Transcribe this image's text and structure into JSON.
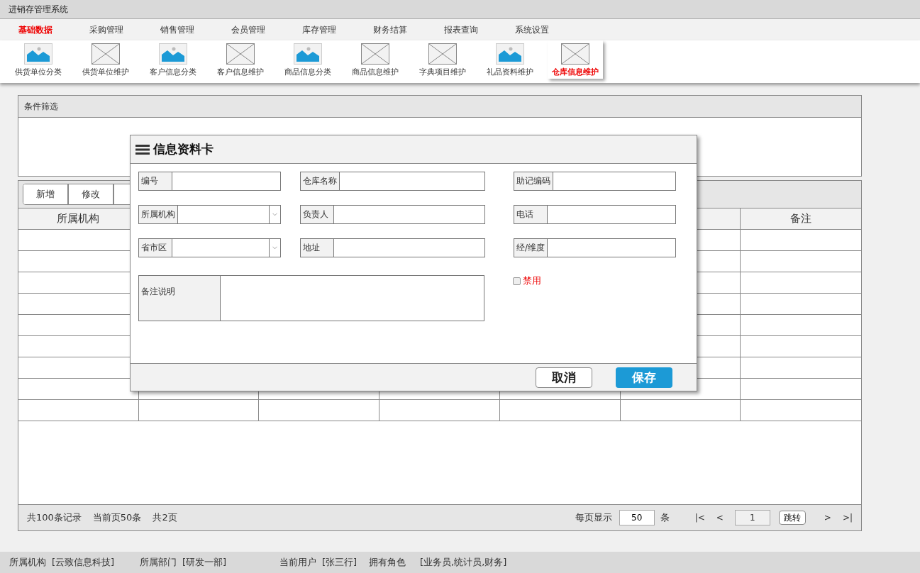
{
  "app_title": "进销存管理系统",
  "menu": [
    {
      "label": "基础数据",
      "selected": true
    },
    {
      "label": "采购管理",
      "selected": false
    },
    {
      "label": "销售管理",
      "selected": false
    },
    {
      "label": "会员管理",
      "selected": false
    },
    {
      "label": "库存管理",
      "selected": false
    },
    {
      "label": "财务结算",
      "selected": false
    },
    {
      "label": "报表查询",
      "selected": false
    },
    {
      "label": "系统设置",
      "selected": false
    }
  ],
  "shortcuts": [
    {
      "label": "供货单位分类",
      "kind": "image",
      "selected": false
    },
    {
      "label": "供货单位维护",
      "kind": "placeholder",
      "selected": false
    },
    {
      "label": "客户信息分类",
      "kind": "image",
      "selected": false
    },
    {
      "label": "客户信息维护",
      "kind": "placeholder",
      "selected": false
    },
    {
      "label": "商品信息分类",
      "kind": "image",
      "selected": false
    },
    {
      "label": "商品信息维护",
      "kind": "placeholder",
      "selected": false
    },
    {
      "label": "字典项目维护",
      "kind": "placeholder",
      "selected": false
    },
    {
      "label": "礼品资料维护",
      "kind": "image",
      "selected": false
    },
    {
      "label": "仓库信息维护",
      "kind": "placeholder",
      "selected": true
    }
  ],
  "filter_panel": {
    "title": "条件筛选"
  },
  "toolbar": [
    "新增",
    "修改"
  ],
  "table": {
    "first_column": "所属机构",
    "last_column": "备注"
  },
  "pager": {
    "total": "共100条记录",
    "current": "当前页50条",
    "pages": "共2页",
    "per_page_label": "每页显示",
    "per_page": "50",
    "per_page_unit": "条",
    "first": "|<",
    "prev": "<",
    "page": "1",
    "jump": "跳转",
    "next": ">",
    "last": ">|"
  },
  "dialog": {
    "title": "信息资料卡",
    "fields": [
      {
        "label": "编号",
        "kind": "text"
      },
      {
        "label": "仓库名称",
        "kind": "text"
      },
      {
        "label": "助记编码",
        "kind": "text"
      },
      {
        "label": "所属机构",
        "kind": "select"
      },
      {
        "label": "负责人",
        "kind": "text"
      },
      {
        "label": "电话",
        "kind": "text"
      },
      {
        "label": "省市区",
        "kind": "select"
      },
      {
        "label": "地址",
        "kind": "text"
      },
      {
        "label": "经/维度",
        "kind": "text"
      }
    ],
    "notes_label": "备注说明",
    "disabled_option": {
      "label": "禁用",
      "checked": false
    },
    "cancel": "取消",
    "save": "保存"
  },
  "status_bar": [
    {
      "label": "所属机构",
      "value": "[云致信息科技]"
    },
    {
      "label": "所属部门",
      "value": "[研发一部]"
    },
    {
      "label": "当前用户",
      "value": "[张三行]"
    },
    {
      "label": "拥有角色",
      "value": "[业务员,统计员,财务]"
    }
  ]
}
